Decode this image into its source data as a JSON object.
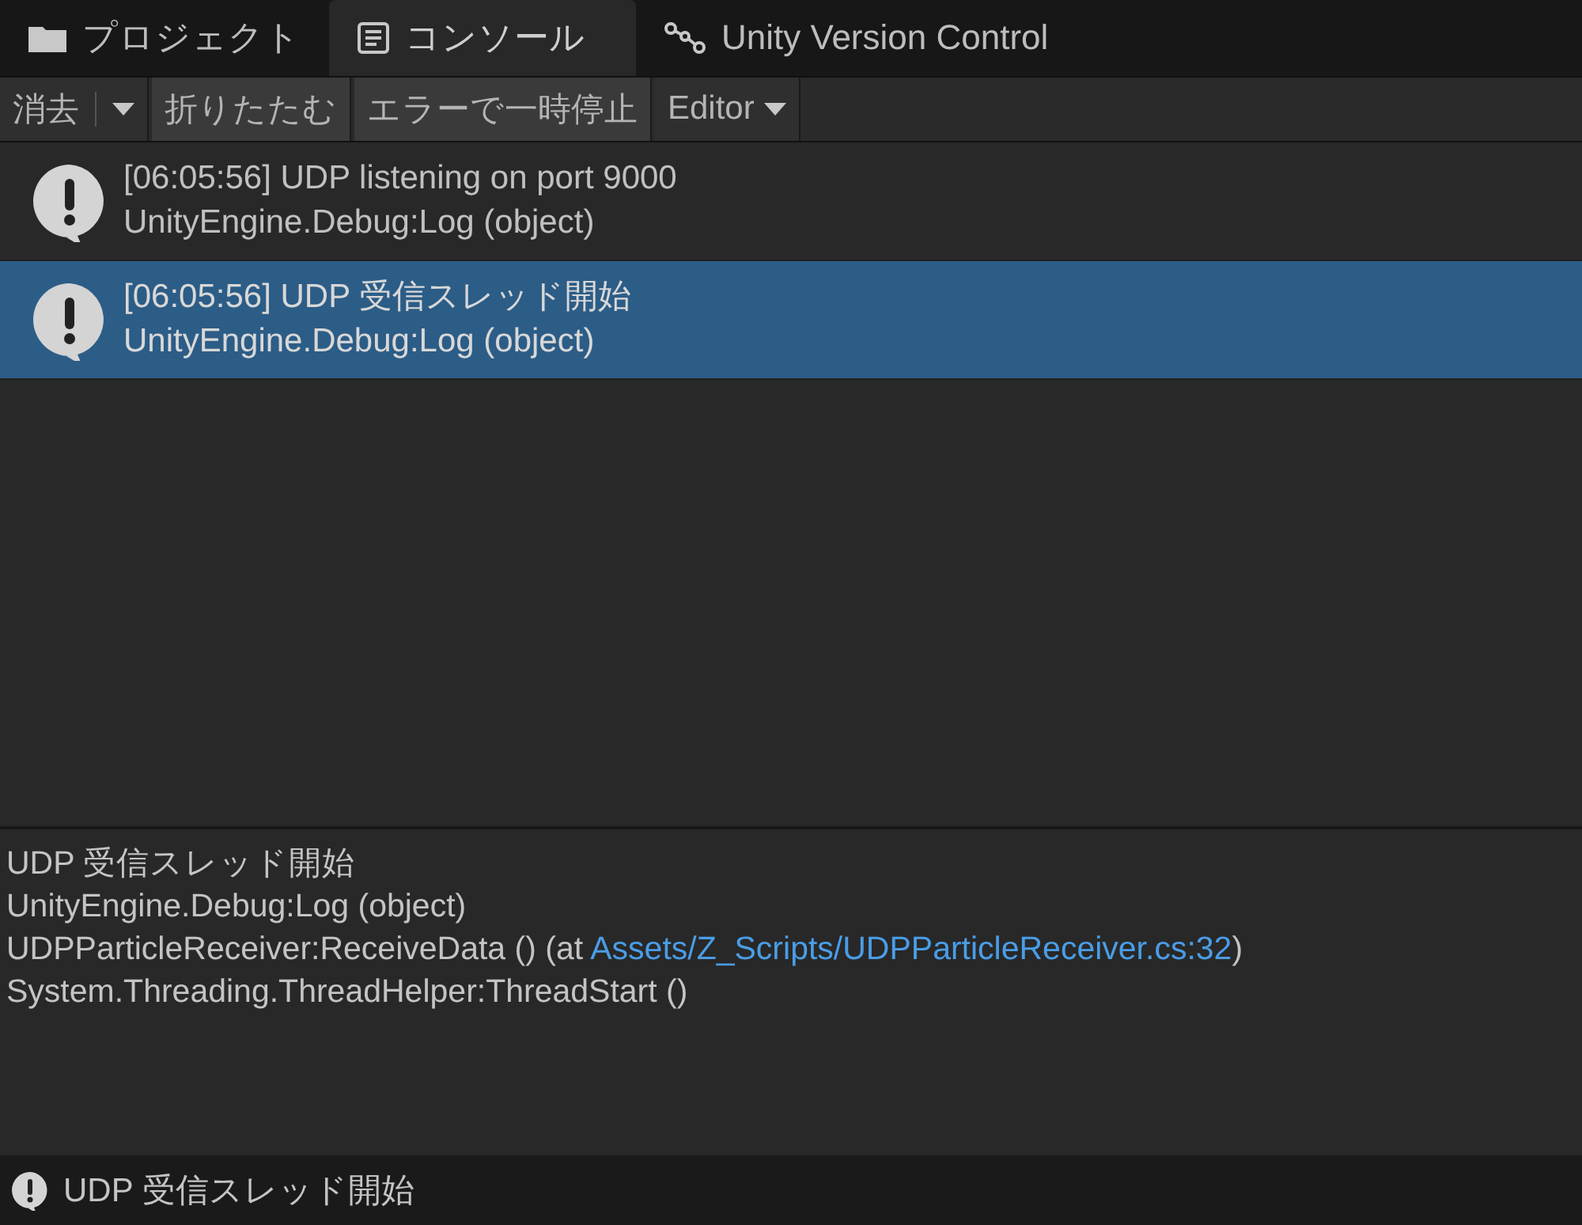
{
  "tabs": [
    {
      "label": "プロジェクト",
      "kind": "folder",
      "selected": false
    },
    {
      "label": "コンソール",
      "kind": "console",
      "selected": true
    },
    {
      "label": "Unity Version Control",
      "kind": "branch",
      "selected": false
    }
  ],
  "toolbar": [
    {
      "kind": "split",
      "label": "消去"
    },
    {
      "kind": "toggle",
      "label": "折りたたむ"
    },
    {
      "kind": "toggle",
      "label": "エラーで一時停止"
    },
    {
      "kind": "dropdown",
      "label": "Editor"
    }
  ],
  "log_entries": [
    {
      "message": "[06:05:56] UDP listening on port 9000",
      "source": "UnityEngine.Debug:Log (object)",
      "selected": false
    },
    {
      "message": "[06:05:56] UDP 受信スレッド開始",
      "source": "UnityEngine.Debug:Log (object)",
      "selected": true
    }
  ],
  "detail_lines": [
    {
      "text": "UDP 受信スレッド開始"
    },
    {
      "text": "UnityEngine.Debug:Log (object)"
    },
    {
      "text": "UDPParticleReceiver:ReceiveData () (at ",
      "link": "Assets/Z_Scripts/UDPParticleReceiver.cs:32",
      "after": ")"
    },
    {
      "text": "System.Threading.ThreadHelper:ThreadStart ()"
    }
  ],
  "status_bar": {
    "message": "UDP 受信スレッド開始"
  }
}
